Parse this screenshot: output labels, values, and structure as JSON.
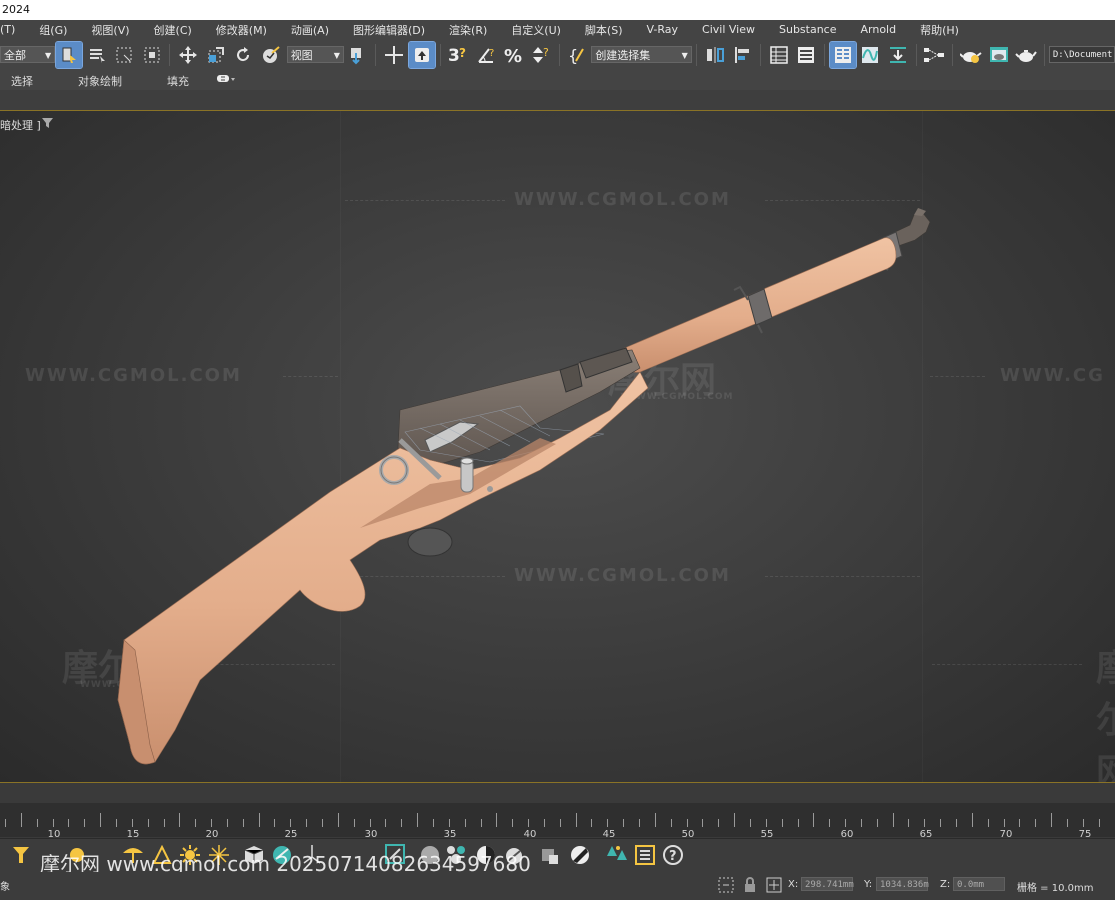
{
  "window": {
    "title_fragment": "2024"
  },
  "menu": {
    "items": [
      "(T)",
      "组(G)",
      "视图(V)",
      "创建(C)",
      "修改器(M)",
      "动画(A)",
      "图形编辑器(D)",
      "渲染(R)",
      "自定义(U)",
      "脚本(S)",
      "V-Ray",
      "Civil View",
      "Substance",
      "Arnold",
      "帮助(H)"
    ]
  },
  "toolbar": {
    "selection_filter": "全部",
    "reference_coord": "视图",
    "named_selection": "创建选择集",
    "path_field": "D:\\Document"
  },
  "ribbon": {
    "tabs": [
      "选择",
      "对象绘制",
      "填充"
    ]
  },
  "viewport": {
    "label": "暗处理 ]",
    "watermark_text": "WWW.CGMOL.COM",
    "watermark_cn": "摩尔网",
    "watermark_cn_sub": "WWW.CGMOL.COM",
    "watermark_clipped": "WWW.CG",
    "model_colors": {
      "stock": "#e8b695",
      "metal": "#7a6f66",
      "band": "#6b6b6b",
      "parts": "#b8b8b8"
    }
  },
  "timeline": {
    "ticks": [
      "10",
      "15",
      "20",
      "25",
      "30",
      "35",
      "40",
      "45",
      "50",
      "55",
      "60",
      "65",
      "70",
      "75"
    ]
  },
  "bottom_watermark": "摩尔网 www.cgmol.com 20250714082634597680",
  "status": {
    "left_text": "象",
    "x_label": "X:",
    "x_value": "298.741mm",
    "y_label": "Y:",
    "y_value": "1034.836m",
    "z_label": "Z:",
    "z_value": "0.0mm",
    "grid_text": "栅格 = 10.0mm"
  },
  "colors": {
    "accent_active": "#5b8cc7",
    "teal_icon": "#3fb6b0",
    "gold_line": "#8a7326"
  }
}
